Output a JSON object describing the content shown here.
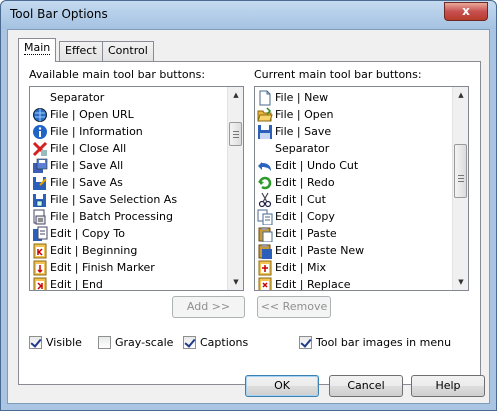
{
  "window": {
    "title": "Tool Bar Options",
    "close_label": "x"
  },
  "tabs": [
    {
      "label": "Main",
      "active": true
    },
    {
      "label": "Effect",
      "active": false
    },
    {
      "label": "Control",
      "active": false
    }
  ],
  "available": {
    "title": "Available main tool bar buttons:",
    "items": [
      {
        "label": "Separator",
        "icon": "none"
      },
      {
        "label": "File | Open URL",
        "icon": "globe-icon"
      },
      {
        "label": "File | Information",
        "icon": "info-icon"
      },
      {
        "label": "File | Close All",
        "icon": "close-all-icon"
      },
      {
        "label": "File | Save All",
        "icon": "save-all-icon"
      },
      {
        "label": "File | Save As",
        "icon": "save-as-icon"
      },
      {
        "label": "File | Save Selection As",
        "icon": "save-selection-icon"
      },
      {
        "label": "File | Batch Processing",
        "icon": "batch-icon"
      },
      {
        "label": "Edit | Copy To",
        "icon": "copy-to-icon"
      },
      {
        "label": "Edit | Beginning",
        "icon": "beginning-icon"
      },
      {
        "label": "Edit | Finish Marker",
        "icon": "finish-marker-icon"
      },
      {
        "label": "Edit | End",
        "icon": "end-icon"
      }
    ],
    "scroll_thumb_fraction": 0.13
  },
  "current": {
    "title": "Current main tool bar buttons:",
    "items": [
      {
        "label": "File | New",
        "icon": "new-file-icon"
      },
      {
        "label": "File | Open",
        "icon": "open-folder-icon"
      },
      {
        "label": "File | Save",
        "icon": "save-icon"
      },
      {
        "label": "Separator",
        "icon": "none"
      },
      {
        "label": "Edit | Undo Cut",
        "icon": "undo-icon"
      },
      {
        "label": "Edit | Redo",
        "icon": "redo-icon"
      },
      {
        "label": "Edit | Cut",
        "icon": "cut-icon"
      },
      {
        "label": "Edit | Copy",
        "icon": "copy-icon"
      },
      {
        "label": "Edit | Paste",
        "icon": "paste-icon"
      },
      {
        "label": "Edit | Paste New",
        "icon": "paste-new-icon"
      },
      {
        "label": "Edit | Mix",
        "icon": "mix-icon"
      },
      {
        "label": "Edit | Replace",
        "icon": "replace-icon"
      }
    ],
    "scroll_thumb_fraction": 0.35
  },
  "buttons": {
    "add": "Add >>",
    "remove": "<< Remove",
    "ok": "OK",
    "cancel": "Cancel",
    "help": "Help"
  },
  "checkboxes": [
    {
      "label": "Visible",
      "checked": true
    },
    {
      "label": "Gray-scale",
      "checked": false
    },
    {
      "label": "Captions",
      "checked": true
    },
    {
      "label": "Tool bar images in menu",
      "checked": true
    }
  ],
  "colors": {
    "accent": "#3c7fb1",
    "title_bar": "#a9c5e3",
    "close_red": "#c75050"
  }
}
